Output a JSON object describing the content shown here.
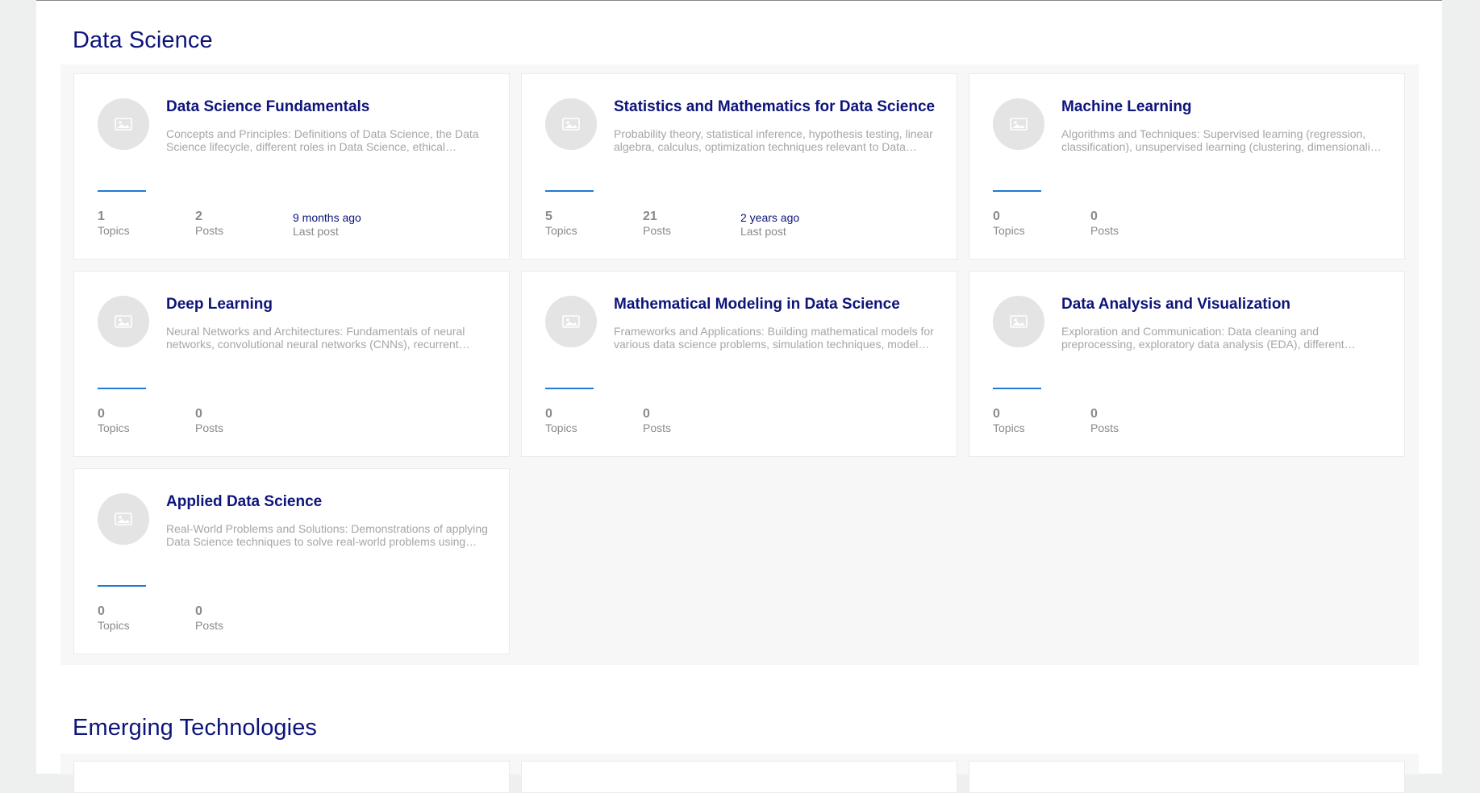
{
  "sections": [
    {
      "title": "Data Science",
      "categories": [
        {
          "title": "Data Science Fundamentals",
          "description": "Concepts and Principles: Definitions of Data Science, the Data Science lifecycle, different roles in Data Science, ethical considerations in data handling and analysis.",
          "topics": "1",
          "topics_label": "Topics",
          "posts": "2",
          "posts_label": "Posts",
          "last_post_time": "9 months ago",
          "last_post_label": "Last post"
        },
        {
          "title": "Statistics and Mathematics for Data Science",
          "description": "Probability theory, statistical inference, hypothesis testing, linear algebra, calculus, optimization techniques relevant to Data Science applications.",
          "topics": "5",
          "topics_label": "Topics",
          "posts": "21",
          "posts_label": "Posts",
          "last_post_time": "2 years ago",
          "last_post_label": "Last post"
        },
        {
          "title": "Machine Learning",
          "description": "Algorithms and Techniques: Supervised learning (regression, classification), unsupervised learning (clustering, dimensionality reduction), model evaluation.",
          "topics": "0",
          "topics_label": "Topics",
          "posts": "0",
          "posts_label": "Posts"
        },
        {
          "title": "Deep Learning",
          "description": "Neural Networks and Architectures: Fundamentals of neural networks, convolutional neural networks (CNNs), recurrent neural networks (RNNs), transformers.",
          "topics": "0",
          "topics_label": "Topics",
          "posts": "0",
          "posts_label": "Posts"
        },
        {
          "title": "Mathematical Modeling in Data Science",
          "description": "Frameworks and Applications: Building mathematical models for various data science problems, simulation techniques, model validation and calibration.",
          "topics": "0",
          "topics_label": "Topics",
          "posts": "0",
          "posts_label": "Posts"
        },
        {
          "title": "Data Analysis and Visualization",
          "description": "Exploration and Communication: Data cleaning and preprocessing, exploratory data analysis (EDA), different visualization tools and techniques.",
          "topics": "0",
          "topics_label": "Topics",
          "posts": "0",
          "posts_label": "Posts"
        },
        {
          "title": "Applied Data Science",
          "description": "Real-World Problems and Solutions: Demonstrations of applying Data Science techniques to solve real-world problems using industry datasets.",
          "topics": "0",
          "topics_label": "Topics",
          "posts": "0",
          "posts_label": "Posts"
        }
      ]
    },
    {
      "title": "Emerging Technologies",
      "categories": []
    }
  ],
  "icons": {
    "category_placeholder": "image-placeholder-icon"
  },
  "colors": {
    "heading": "#0d147a",
    "accent": "#1f7bd6",
    "muted": "#a6a6a6"
  }
}
